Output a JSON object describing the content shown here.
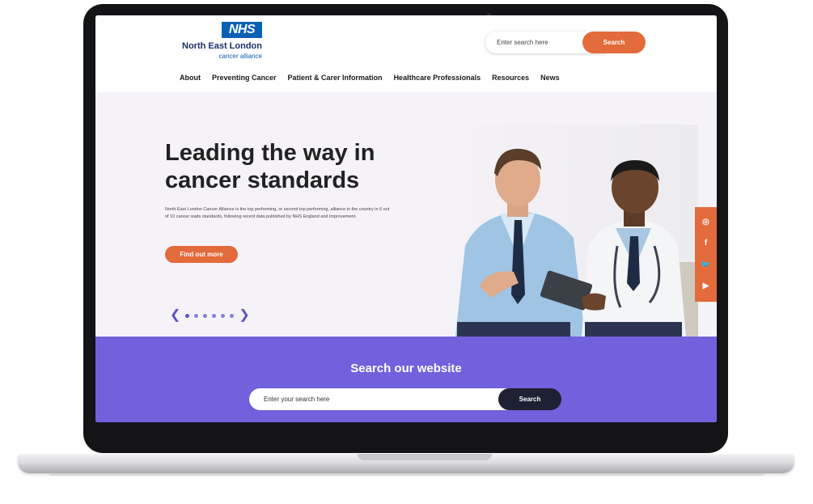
{
  "header": {
    "logo": {
      "badge": "NHS",
      "organisation": "North East London",
      "subtitle": "cancer alliance"
    },
    "search": {
      "placeholder": "Enter search here",
      "button_label": "Search"
    },
    "nav": [
      {
        "label": "About"
      },
      {
        "label": "Preventing Cancer"
      },
      {
        "label": "Patient & Carer Information"
      },
      {
        "label": "Healthcare Professionals"
      },
      {
        "label": "Resources"
      },
      {
        "label": "News"
      }
    ]
  },
  "hero": {
    "title": "Leading the way in cancer standards",
    "text": "North East London Cancer Alliance is the top performing, or second top performing, alliance in the country in 6 out of 10 cancer waits standards, following recent data published by NHS England and Improvement.",
    "cta_label": "Find out more",
    "carousel": {
      "prev": "❮",
      "next": "❯",
      "slide_count": 6,
      "active_index": 0
    }
  },
  "social": [
    {
      "icon": "instagram-icon",
      "glyph": "◎"
    },
    {
      "icon": "facebook-icon",
      "glyph": "f"
    },
    {
      "icon": "twitter-icon",
      "glyph": "🐦"
    },
    {
      "icon": "youtube-icon",
      "glyph": "▶"
    }
  ],
  "search_section": {
    "title": "Search our website",
    "placeholder": "Enter your search here",
    "button_label": "Search"
  },
  "colors": {
    "accent_orange": "#e36a3b",
    "accent_purple": "#7161dc",
    "nhs_blue": "#0b5fb5",
    "dark_button": "#1e2033"
  }
}
